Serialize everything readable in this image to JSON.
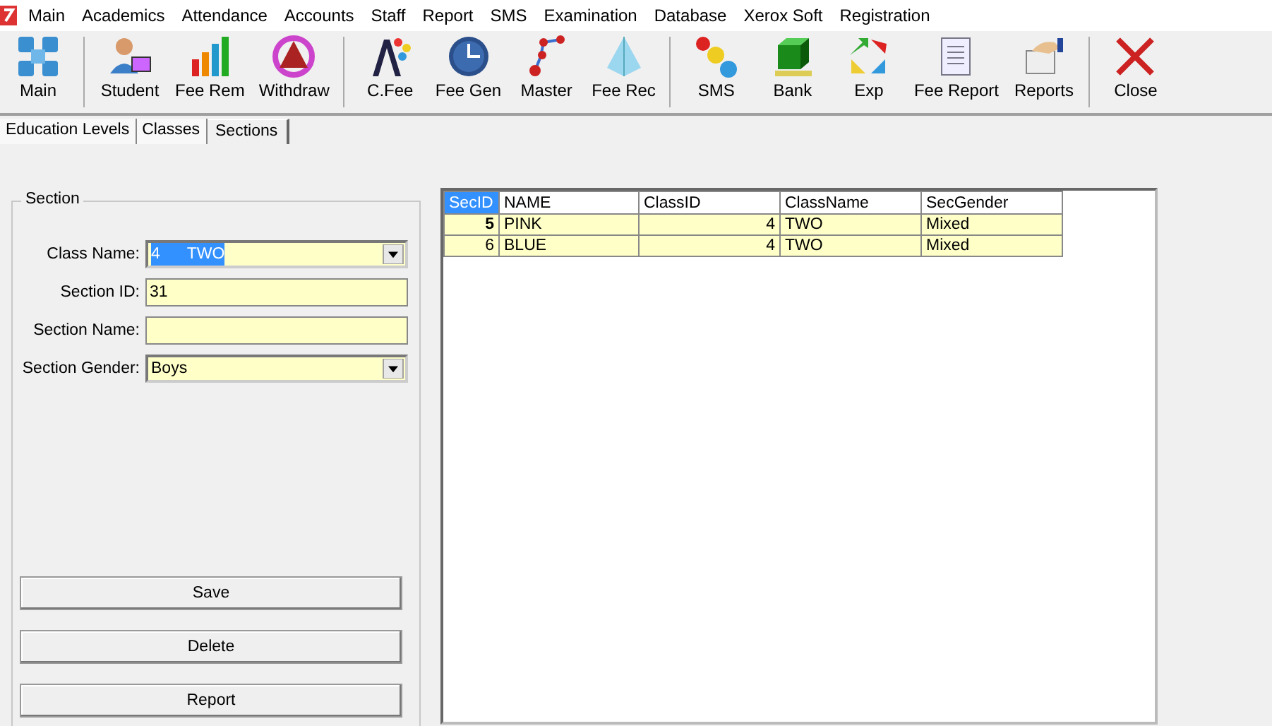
{
  "menu": [
    "Main",
    "Academics",
    "Attendance",
    "Accounts",
    "Staff",
    "Report",
    "SMS",
    "Examination",
    "Database",
    "Xerox Soft",
    "Registration"
  ],
  "toolbar": {
    "groups": [
      [
        {
          "label": "Main",
          "kind": "grid"
        }
      ],
      [
        {
          "label": "Student",
          "kind": "user"
        },
        {
          "label": "Fee Rem",
          "kind": "bars"
        },
        {
          "label": "Withdraw",
          "kind": "ring"
        }
      ],
      [
        {
          "label": "C.Fee",
          "kind": "letter"
        },
        {
          "label": "Fee Gen",
          "kind": "clock"
        },
        {
          "label": "Master",
          "kind": "nodes"
        },
        {
          "label": "Fee Rec",
          "kind": "pyramid"
        }
      ],
      [
        {
          "label": "SMS",
          "kind": "balls"
        },
        {
          "label": "Bank",
          "kind": "cube"
        },
        {
          "label": "Exp",
          "kind": "arrows"
        },
        {
          "label": "Fee Report",
          "kind": "scroll"
        },
        {
          "label": "Reports",
          "kind": "hand"
        }
      ],
      [
        {
          "label": "Close",
          "kind": "cross"
        }
      ]
    ]
  },
  "tabs": [
    {
      "label": "Education Levels",
      "selected": false
    },
    {
      "label": "Classes",
      "selected": false
    },
    {
      "label": "Sections",
      "selected": true
    }
  ],
  "section": {
    "title": "Section",
    "fields": [
      {
        "label": "Class Name:",
        "kind": "combo",
        "value": "4      TWO",
        "highlighted": true
      },
      {
        "label": "Section ID:",
        "kind": "text",
        "value": "31",
        "highlighted": false
      },
      {
        "label": "Section Name:",
        "kind": "text",
        "highlighted": false
      },
      {
        "label": "Section Gender:",
        "kind": "combo",
        "value": "Boys",
        "highlighted": false
      }
    ],
    "buttons": [
      "Save",
      "Delete",
      "Report"
    ]
  },
  "table": {
    "columns": [
      {
        "label": "SecID",
        "selected": true
      },
      {
        "label": "NAME",
        "selected": false
      },
      {
        "label": "ClassID",
        "selected": false
      },
      {
        "label": "ClassName",
        "selected": false
      },
      {
        "label": "SecGender",
        "selected": false
      }
    ],
    "rows": [
      {
        "cells": [
          "5",
          "PINK",
          "4",
          "TWO",
          "Mixed"
        ],
        "current": true
      },
      {
        "cells": [
          "6",
          "BLUE",
          "4",
          "TWO",
          "Mixed"
        ],
        "current": false
      }
    ]
  }
}
